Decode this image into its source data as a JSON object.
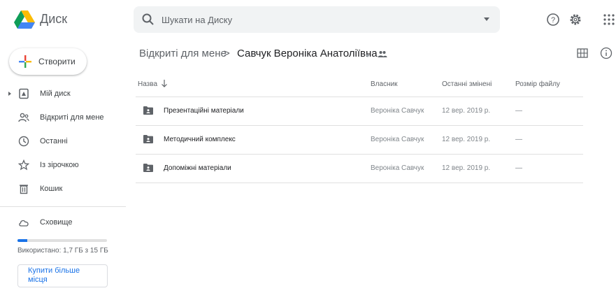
{
  "app": {
    "name": "Диск"
  },
  "search": {
    "placeholder": "Шукати на Диску"
  },
  "header_icons": [
    "help-icon",
    "settings-icon",
    "apps-icon"
  ],
  "sidebar": {
    "new_label": "Створити",
    "items": [
      {
        "label": "Мій диск",
        "icon": "my-drive-icon"
      },
      {
        "label": "Відкриті для мене",
        "icon": "shared-icon"
      },
      {
        "label": "Останні",
        "icon": "recent-icon"
      },
      {
        "label": "Із зірочкою",
        "icon": "star-icon"
      },
      {
        "label": "Кошик",
        "icon": "trash-icon"
      }
    ],
    "storage": {
      "label": "Сховище",
      "used_text": "Використано: 1,7 ГБ з 15 ГБ",
      "used_fraction": 0.113,
      "buy_label": "Купити більше місця"
    }
  },
  "breadcrumb": {
    "parent": "Відкриті для мене",
    "separator": ">",
    "current": "Савчук Вероніка Анатоліївна"
  },
  "table": {
    "headers": {
      "name": "Назва",
      "owner": "Власник",
      "modified": "Останні змінені",
      "size": "Розмір файлу"
    },
    "rows": [
      {
        "name": "Презентаційні матеріали",
        "owner": "Вероніка Савчук",
        "modified": "12 вер. 2019 р.",
        "size": "—"
      },
      {
        "name": "Методичний комплекс",
        "owner": "Вероніка Савчук",
        "modified": "12 вер. 2019 р.",
        "size": "—"
      },
      {
        "name": "Допоміжні матеріали",
        "owner": "Вероніка Савчук",
        "modified": "12 вер. 2019 р.",
        "size": "—"
      }
    ]
  },
  "colors": {
    "accent": "#1a73e8",
    "text": "#3c4043",
    "muted": "#80868b",
    "folder": "#5f6368"
  }
}
